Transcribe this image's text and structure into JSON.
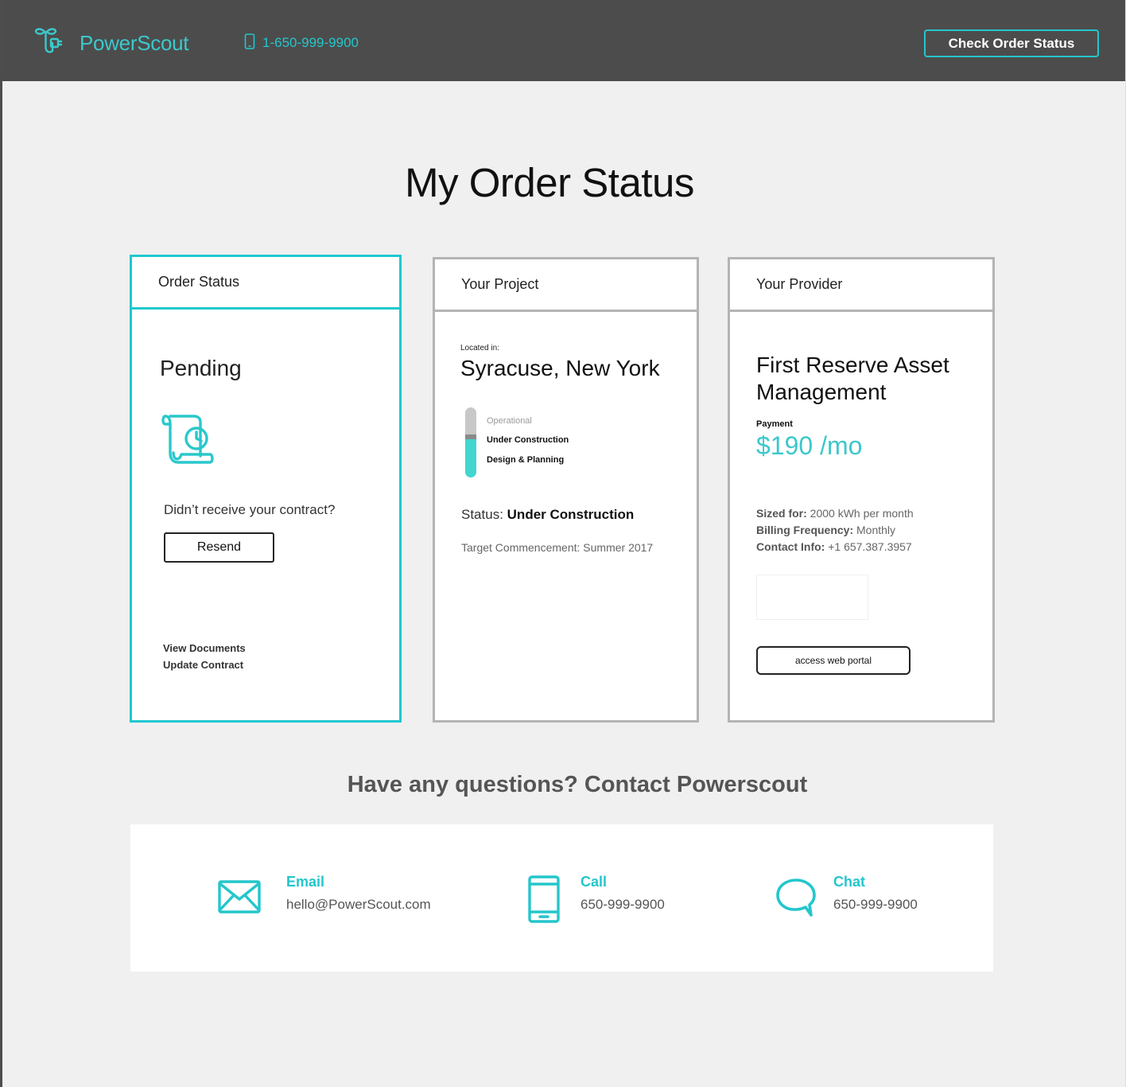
{
  "header": {
    "brand": "PowerScout",
    "phone": "1-650-999-9900",
    "check_order_button": "Check Order Status"
  },
  "page_title": "My Order Status",
  "order_card": {
    "title": "Order Status",
    "status": "Pending",
    "contract_question": "Didn’t receive your contract?",
    "resend_label": "Resend",
    "links": [
      "View Documents",
      "Update Contract"
    ]
  },
  "project_card": {
    "title": "Your Project",
    "located_label": "Located in:",
    "location": "Syracuse, New York",
    "stages": [
      "Operational",
      "Under Construction",
      "Design & Planning"
    ],
    "current_stage": "Under Construction",
    "progress_fraction": 0.55,
    "status_label": "Status:",
    "status_value": "Under Construction",
    "target": "Target Commencement: Summer 2017"
  },
  "provider_card": {
    "title": "Your Provider",
    "name": "First Reserve Asset Management",
    "payment_label": "Payment",
    "payment_value": "$190 /mo",
    "sized_for_label": "Sized for:",
    "sized_for_value": "2000 kWh per month",
    "billing_label": "Billing Frequency:",
    "billing_value": "Monthly",
    "contact_label": "Contact Info:",
    "contact_value": "+1 657.387.3957",
    "portal_button": "access web portal"
  },
  "contact": {
    "title": "Have any questions? Contact Powerscout",
    "items": [
      {
        "label": "Email",
        "value": "hello@PowerScout.com",
        "icon": "envelope-icon"
      },
      {
        "label": "Call",
        "value": "650-999-9900",
        "icon": "mobile-phone-icon"
      },
      {
        "label": "Chat",
        "value": "650-999-9900",
        "icon": "chat-bubble-icon"
      }
    ]
  },
  "colors": {
    "accent": "#24c6cc",
    "header_bg": "#4c4c4c",
    "page_bg": "#f0f0f0",
    "card_border": "#b4b4b4",
    "progress_fill": "#42d6cf"
  }
}
